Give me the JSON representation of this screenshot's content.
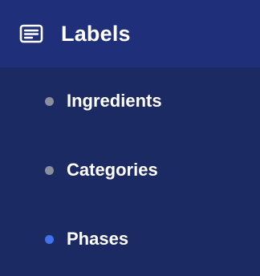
{
  "section": {
    "title": "Labels",
    "icon": "notes-icon",
    "header_bg": "#1f2f79"
  },
  "items": [
    {
      "label": "Ingredients",
      "active": false,
      "bullet_color": "#8a8f9d"
    },
    {
      "label": "Categories",
      "active": false,
      "bullet_color": "#8a8f9d"
    },
    {
      "label": "Phases",
      "active": true,
      "bullet_color": "#3f73e7"
    }
  ],
  "colors": {
    "sidebar_bg": "#1b2a63",
    "text": "#ffffff",
    "inactive_bullet": "#8a8f9d",
    "active_bullet": "#3f73e7"
  }
}
